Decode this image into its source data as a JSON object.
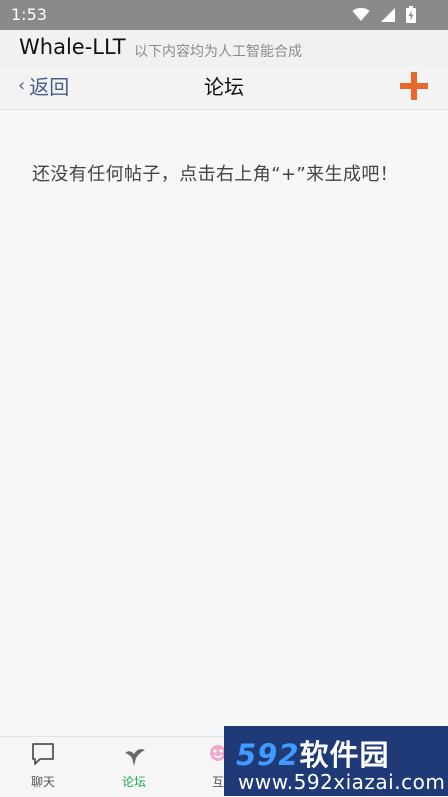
{
  "status_bar": {
    "time": "1:53",
    "icons": [
      "wifi-icon",
      "cellular-signal-icon",
      "battery-charging-icon"
    ]
  },
  "app_header": {
    "title": "Whale-LLT",
    "subtitle": "以下内容均为人工智能合成"
  },
  "nav": {
    "back_label": "返回",
    "title": "论坛",
    "add_icon": "plus-icon",
    "accent_color": "#e8672a"
  },
  "content": {
    "empty_message": "还没有任何帖子，点击右上角“+”来生成吧！"
  },
  "tabs": [
    {
      "label": "聊天",
      "icon": "chat-bubble-icon",
      "active": false
    },
    {
      "label": "论坛",
      "icon": "forum-icon",
      "active": true
    },
    {
      "label": "互",
      "icon": "interaction-icon",
      "active": false
    }
  ],
  "watermark": {
    "logo_digits": "592",
    "logo_text": "软件园",
    "url": "www.592xiazai.com"
  }
}
